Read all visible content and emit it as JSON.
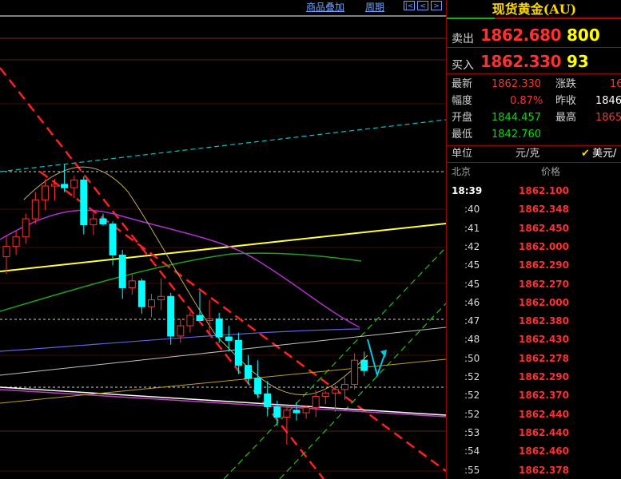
{
  "menu": {
    "overlay": "商品叠加",
    "period": "周期",
    "nav": [
      "|<",
      "<",
      ">"
    ]
  },
  "quote": {
    "title": "现货黄金(AU)",
    "sell_label": "卖出",
    "sell_price": "1862.680",
    "sell_vol": "800",
    "buy_label": "买入",
    "buy_price": "1862.330",
    "buy_vol": "93",
    "stats": {
      "latest_label": "最新",
      "latest": "1862.330",
      "change_label": "涨跌",
      "change": "16",
      "pct_label": "幅度",
      "pct": "0.87%",
      "prev_label": "昨收",
      "prev": "1846",
      "open_label": "开盘",
      "open": "1844.457",
      "high_label": "最高",
      "high": "1865",
      "low_label": "最低",
      "low": "1842.760"
    },
    "unit_label": "单位",
    "unit": "元/克",
    "unit2": "美元/"
  },
  "ticks": {
    "header_city": "北京",
    "header_price": "价格",
    "rows": [
      {
        "t": "18:39",
        "p": "1862.100"
      },
      {
        "t": ":40",
        "p": "1862.348"
      },
      {
        "t": ":41",
        "p": "1862.450"
      },
      {
        "t": ":42",
        "p": "1862.000"
      },
      {
        "t": ":45",
        "p": "1862.290"
      },
      {
        "t": ":45",
        "p": "1862.270"
      },
      {
        "t": ":46",
        "p": "1862.000"
      },
      {
        "t": ":47",
        "p": "1862.380"
      },
      {
        "t": ":48",
        "p": "1862.430"
      },
      {
        "t": ":50",
        "p": "1862.278"
      },
      {
        "t": ":52",
        "p": "1862.290"
      },
      {
        "t": ":52",
        "p": "1862.370"
      },
      {
        "t": ":52",
        "p": "1862.440"
      },
      {
        "t": ":53",
        "p": "1862.440"
      },
      {
        "t": ":54",
        "p": "1862.460"
      },
      {
        "t": ":55",
        "p": "1862.378"
      }
    ]
  },
  "colors": {
    "up": "#00ffff",
    "down": "#000000",
    "up_border": "#ff3030",
    "accent": "#ffd800"
  },
  "chart_data": {
    "type": "candlestick",
    "ylim": [
      1830,
      1880
    ],
    "candles": [
      {
        "o": 1853.0,
        "h": 1855.5,
        "l": 1851.0,
        "c": 1854.2
      },
      {
        "o": 1854.2,
        "h": 1856.0,
        "l": 1853.2,
        "c": 1855.3
      },
      {
        "o": 1855.3,
        "h": 1858.0,
        "l": 1854.5,
        "c": 1857.4
      },
      {
        "o": 1857.4,
        "h": 1860.5,
        "l": 1856.8,
        "c": 1859.6
      },
      {
        "o": 1859.6,
        "h": 1862.0,
        "l": 1858.4,
        "c": 1861.2
      },
      {
        "o": 1861.2,
        "h": 1862.0,
        "l": 1859.5,
        "c": 1861.4
      },
      {
        "o": 1861.4,
        "h": 1863.7,
        "l": 1860.5,
        "c": 1861.0
      },
      {
        "o": 1861.0,
        "h": 1862.4,
        "l": 1859.8,
        "c": 1861.9
      },
      {
        "o": 1861.9,
        "h": 1862.3,
        "l": 1855.6,
        "c": 1856.7
      },
      {
        "o": 1856.7,
        "h": 1858.1,
        "l": 1855.5,
        "c": 1857.4
      },
      {
        "o": 1857.4,
        "h": 1858.0,
        "l": 1856.6,
        "c": 1856.8
      },
      {
        "o": 1856.8,
        "h": 1857.1,
        "l": 1852.0,
        "c": 1853.2
      },
      {
        "o": 1853.2,
        "h": 1853.8,
        "l": 1848.1,
        "c": 1849.4
      },
      {
        "o": 1849.4,
        "h": 1851.0,
        "l": 1848.6,
        "c": 1850.2
      },
      {
        "o": 1850.2,
        "h": 1850.5,
        "l": 1846.4,
        "c": 1847.2
      },
      {
        "o": 1847.2,
        "h": 1848.7,
        "l": 1846.0,
        "c": 1848.0
      },
      {
        "o": 1848.0,
        "h": 1850.5,
        "l": 1846.8,
        "c": 1848.4
      },
      {
        "o": 1848.4,
        "h": 1848.8,
        "l": 1842.8,
        "c": 1843.8
      },
      {
        "o": 1843.8,
        "h": 1845.8,
        "l": 1843.0,
        "c": 1845.0
      },
      {
        "o": 1845.0,
        "h": 1846.6,
        "l": 1844.2,
        "c": 1846.2
      },
      {
        "o": 1846.2,
        "h": 1849.0,
        "l": 1845.6,
        "c": 1845.6
      },
      {
        "o": 1845.6,
        "h": 1848.0,
        "l": 1844.1,
        "c": 1845.8
      },
      {
        "o": 1845.8,
        "h": 1846.5,
        "l": 1843.0,
        "c": 1843.7
      },
      {
        "o": 1843.7,
        "h": 1845.0,
        "l": 1842.0,
        "c": 1843.3
      },
      {
        "o": 1843.3,
        "h": 1844.2,
        "l": 1839.4,
        "c": 1840.4
      },
      {
        "o": 1840.4,
        "h": 1841.6,
        "l": 1838.2,
        "c": 1838.9
      },
      {
        "o": 1838.9,
        "h": 1841.0,
        "l": 1836.6,
        "c": 1837.1
      },
      {
        "o": 1837.1,
        "h": 1838.6,
        "l": 1834.5,
        "c": 1835.6
      },
      {
        "o": 1835.6,
        "h": 1836.3,
        "l": 1833.4,
        "c": 1834.4
      },
      {
        "o": 1834.4,
        "h": 1835.6,
        "l": 1831.2,
        "c": 1835.2
      },
      {
        "o": 1835.2,
        "h": 1836.1,
        "l": 1834.0,
        "c": 1834.9
      },
      {
        "o": 1834.9,
        "h": 1835.7,
        "l": 1834.2,
        "c": 1835.5
      },
      {
        "o": 1835.5,
        "h": 1837.5,
        "l": 1834.4,
        "c": 1836.8
      },
      {
        "o": 1836.8,
        "h": 1837.4,
        "l": 1835.9,
        "c": 1837.2
      },
      {
        "o": 1837.2,
        "h": 1838.1,
        "l": 1835.0,
        "c": 1837.6
      },
      {
        "o": 1837.6,
        "h": 1839.0,
        "l": 1836.4,
        "c": 1838.2
      },
      {
        "o": 1838.2,
        "h": 1841.8,
        "l": 1837.6,
        "c": 1841.0
      },
      {
        "o": 1841.0,
        "h": 1842.0,
        "l": 1839.2,
        "c": 1839.8
      }
    ]
  }
}
